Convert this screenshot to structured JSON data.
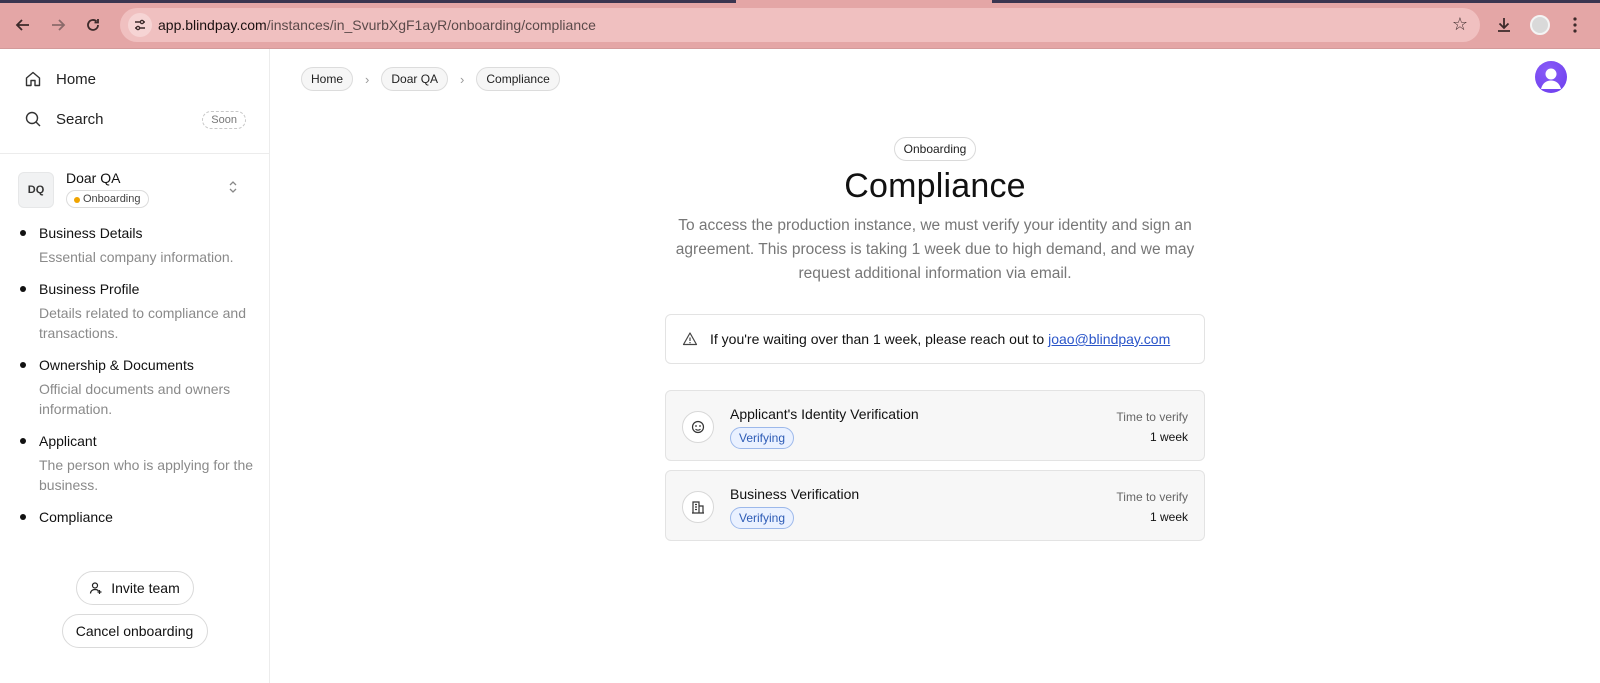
{
  "browser": {
    "url_host": "app.blindpay.com",
    "url_path": "/instances/in_SvurbXgF1ayR/onboarding/compliance"
  },
  "sidebar": {
    "home_label": "Home",
    "search_label": "Search",
    "search_badge": "Soon",
    "org": {
      "initials": "DQ",
      "name": "Doar QA",
      "status": "Onboarding"
    },
    "steps": [
      {
        "title": "Business Details",
        "desc": "Essential company information."
      },
      {
        "title": "Business Profile",
        "desc": "Details related to compliance and transactions."
      },
      {
        "title": "Ownership & Documents",
        "desc": "Official documents and owners information."
      },
      {
        "title": "Applicant",
        "desc": "The person who is applying for the business."
      },
      {
        "title": "Compliance",
        "desc": ""
      }
    ],
    "invite_label": "Invite team",
    "cancel_label": "Cancel onboarding"
  },
  "breadcrumb": [
    "Home",
    "Doar QA",
    "Compliance"
  ],
  "main": {
    "tag": "Onboarding",
    "title": "Compliance",
    "description": "To access the production instance, we must verify your identity and sign an agreement. This process is taking 1 week due to high demand, and we may request additional information via email.",
    "notice_text": "If you're waiting over than 1 week, please reach out to",
    "notice_email": "joao@blindpay.com",
    "verifications": [
      {
        "title": "Applicant's Identity Verification",
        "status": "Verifying",
        "time_label": "Time to verify",
        "time_value": "1 week",
        "icon": "face-icon"
      },
      {
        "title": "Business Verification",
        "status": "Verifying",
        "time_label": "Time to verify",
        "time_value": "1 week",
        "icon": "building-icon"
      }
    ]
  }
}
